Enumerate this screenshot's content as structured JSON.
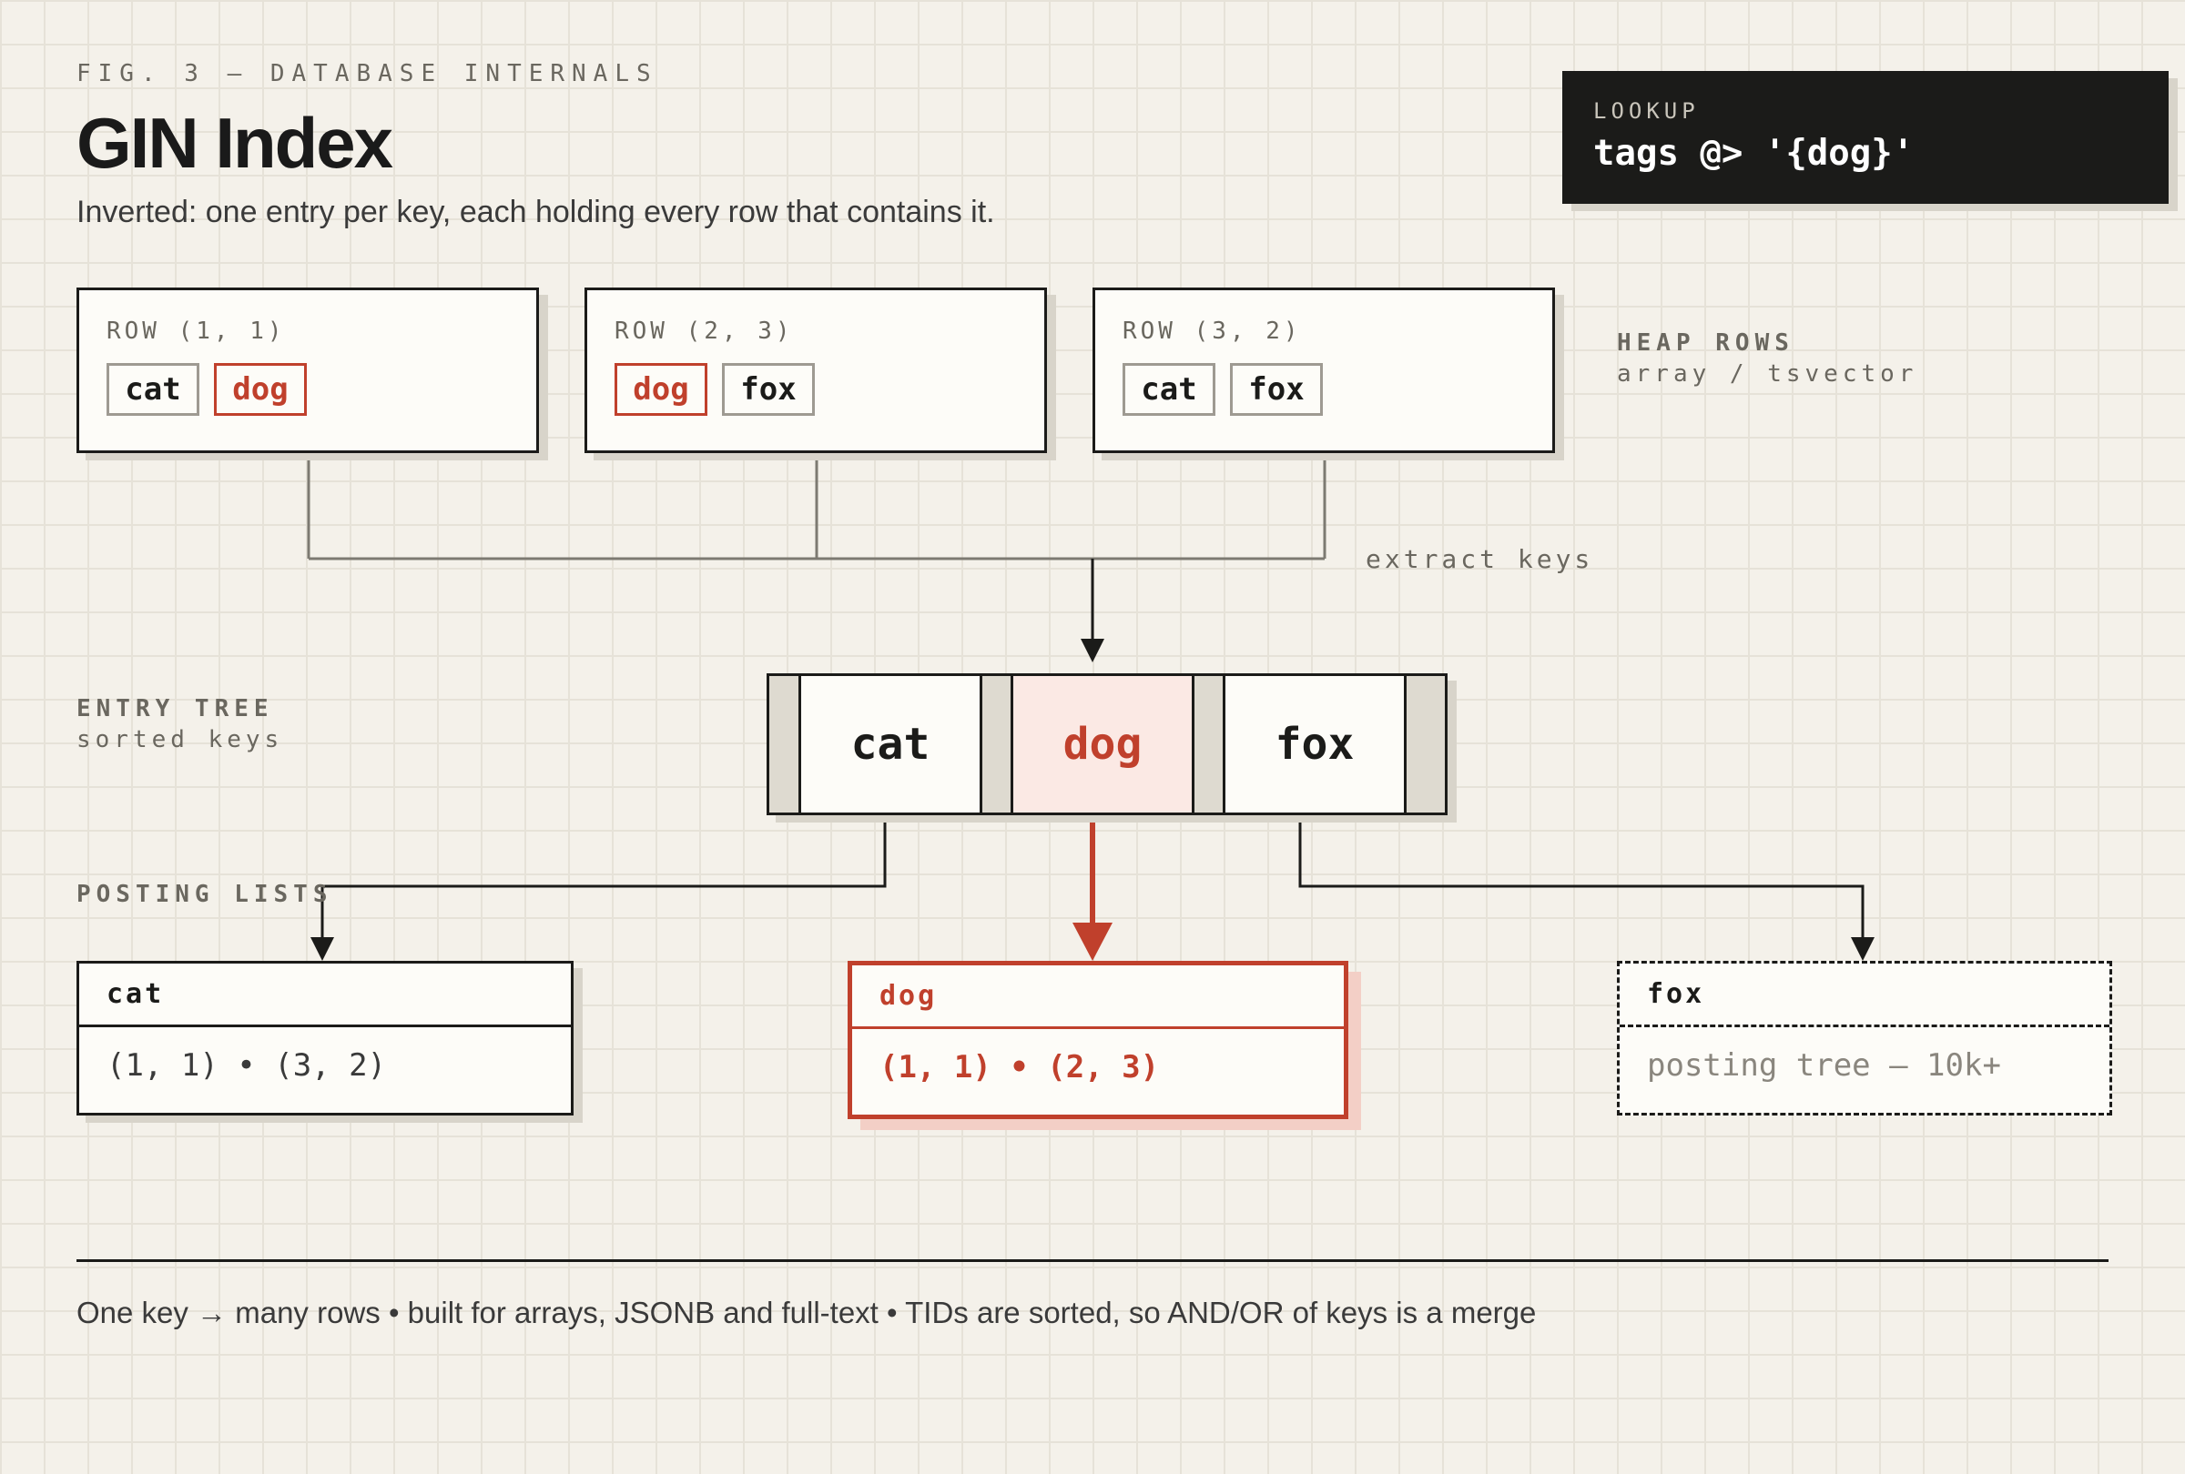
{
  "header": {
    "fig_label": "FIG. 3 — DATABASE INTERNALS",
    "title": "GIN Index",
    "subtitle": "Inverted: one entry per key, each holding every row that contains it."
  },
  "lookup": {
    "label": "LOOKUP",
    "query": "tags @> '{dog}'"
  },
  "heap_rows": [
    {
      "label": "ROW (1, 1)",
      "keys": [
        "cat",
        "dog"
      ]
    },
    {
      "label": "ROW (2, 3)",
      "keys": [
        "dog",
        "fox"
      ]
    },
    {
      "label": "ROW (3, 2)",
      "keys": [
        "cat",
        "fox"
      ]
    }
  ],
  "heap_rows_caption": {
    "title": "HEAP ROWS",
    "subtitle": "array / tsvector"
  },
  "extract_label": "extract keys",
  "entry_tree": {
    "title": "ENTRY TREE",
    "subtitle": "sorted keys",
    "keys": [
      "cat",
      "dog",
      "fox"
    ]
  },
  "posting_lists_label": "POSTING LISTS",
  "posting_lists": [
    {
      "key": "cat",
      "content": "(1, 1)  •  (3, 2)"
    },
    {
      "key": "dog",
      "content": "(1, 1)  •  (2, 3)"
    },
    {
      "key": "fox",
      "content": "posting tree — 10k+"
    }
  ],
  "highlight_key": "dog",
  "colors": {
    "accent": "#c0402c",
    "ink": "#1b1b19",
    "muted": "#6a675f",
    "paper": "#f4f1ea",
    "connector": "#7d7a72"
  },
  "footer": "One key → many rows • built for arrays, JSONB and full-text • TIDs are sorted, so AND/OR of keys is a merge"
}
